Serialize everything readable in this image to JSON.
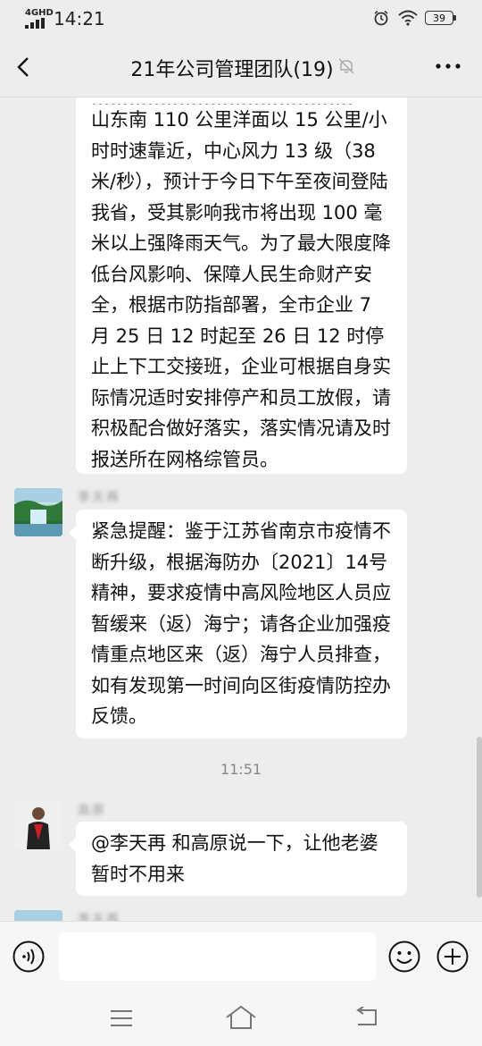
{
  "status_bar": {
    "network": "4GHD",
    "time": "14:21",
    "battery": "39"
  },
  "header": {
    "title": "21年公司管理团队(19)"
  },
  "messages": [
    {
      "cut_line": "……………………………………",
      "text": "山东南 110 公里洋面以 15 公里/小时时速靠近，中心风力 13 级（38 米/秒），预计于今日下午至夜间登陆我省，受其影响我市将出现 100 毫米以上强降雨天气。为了最大限度降低台风影响、保障人民生命财产安全，根据市防指部署，全市企业 7 月 25 日 12 时起至 26 日 12 时停止上下工交接班，企业可根据自身实际情况适时安排停产和员工放假，请积极配合做好落实，落实情况请及时报送所在网格综管员。"
    },
    {
      "sender": "李天再",
      "text": "紧急提醒：鉴于江苏省南京市疫情不断升级，根据海防办〔2021〕14号精神，要求疫情中高风险地区人员应暂缓来（返）海宁；请各企业加强疫情重点地区来（返）海宁人员排查，如有发现第一时间向区街疫情防控办反馈。"
    },
    {
      "time": "11:51"
    },
    {
      "sender": "高原",
      "text": "@李天再  和高原说一下，让他老婆暂时不用来"
    },
    {
      "sender": "李天再"
    }
  ],
  "input": {
    "placeholder": ""
  },
  "icons": {
    "back": "back-arrow-icon",
    "mute": "mute-bell-icon",
    "more": "more-dots-icon",
    "voice": "voice-icon",
    "emoji": "emoji-icon",
    "plus": "plus-icon"
  }
}
